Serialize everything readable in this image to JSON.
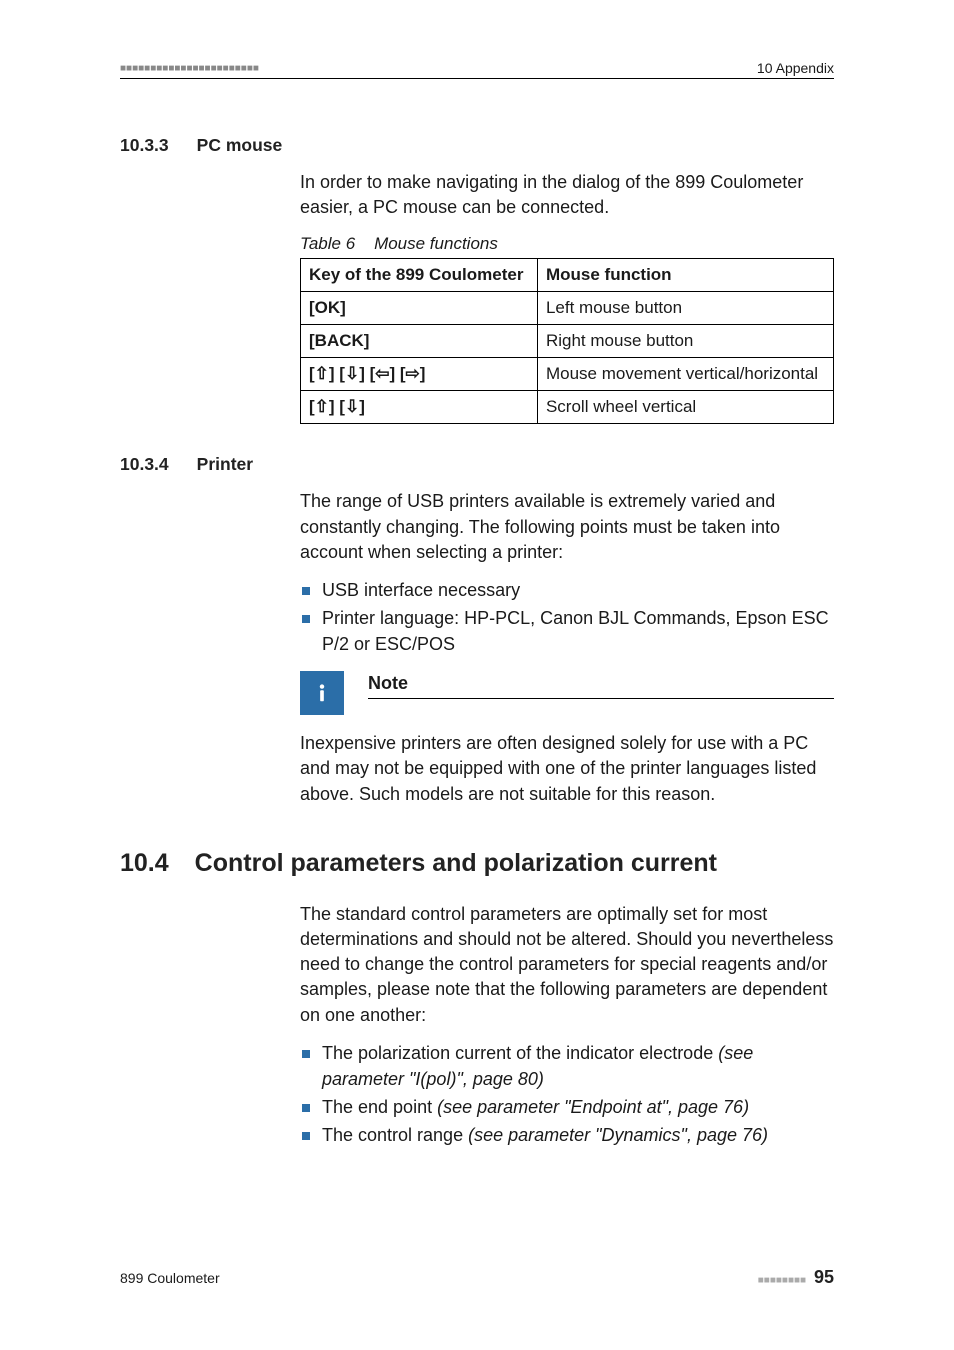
{
  "header": {
    "bar_left": "■■■■■■■■■■■■■■■■■■■■■■■",
    "bar_right": "10 Appendix"
  },
  "sec_10_3_3": {
    "num": "10.3.3",
    "title": "PC mouse",
    "para": "In order to make navigating in the dialog of the 899 Coulometer easier, a PC mouse can be connected.",
    "table_caption_num": "Table 6",
    "table_caption_txt": "Mouse functions",
    "th1": "Key of the 899 Coulometer",
    "th2": "Mouse function",
    "rows": [
      {
        "k": "[OK]",
        "v": "Left mouse button"
      },
      {
        "k": "[BACK]",
        "v": "Right mouse button"
      },
      {
        "k": "[⇧] [⇩] [⇦] [⇨]",
        "v": "Mouse movement vertical/horizontal"
      },
      {
        "k": "[⇧] [⇩]",
        "v": "Scroll wheel vertical"
      }
    ]
  },
  "sec_10_3_4": {
    "num": "10.3.4",
    "title": "Printer",
    "para": "The range of USB printers available is extremely varied and constantly changing. The following points must be taken into account when selecting a printer:",
    "bullets": [
      "USB interface necessary",
      "Printer language: HP-PCL, Canon BJL Commands, Epson ESC P/2 or ESC/POS"
    ],
    "note_label": "Note",
    "note_icon": "i",
    "note_body": "Inexpensive printers are often designed solely for use with a PC and may not be equipped with one of the printer languages listed above. Such models are not suitable for this reason."
  },
  "sec_10_4": {
    "num": "10.4",
    "title": "Control parameters and polarization current",
    "para": "The standard control parameters are optimally set for most determinations and should not be altered. Should you nevertheless need to change the control parameters for special reagents and/or samples, please note that the following parameters are dependent on one another:",
    "bullets": [
      {
        "txt": "The polarization current of the indicator electrode ",
        "ref": "(see parameter \"I(pol)\", page 80)"
      },
      {
        "txt": "The end point ",
        "ref": "(see parameter \"Endpoint at\", page 76)"
      },
      {
        "txt": "The control range ",
        "ref": "(see parameter \"Dynamics\", page 76)"
      }
    ]
  },
  "footer": {
    "left": "899 Coulometer",
    "squares": "■■■■■■■■",
    "page": "95"
  }
}
